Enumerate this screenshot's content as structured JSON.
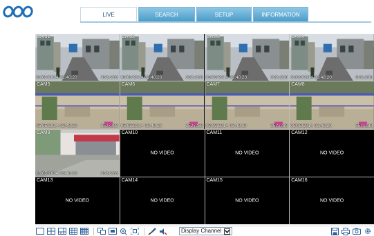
{
  "tabs": [
    {
      "label": "LIVE",
      "active": true
    },
    {
      "label": "SEARCH",
      "active": false
    },
    {
      "label": "SETUP",
      "active": false
    },
    {
      "label": "INFORMATION",
      "active": false
    }
  ],
  "cameras": [
    {
      "label": "CAM1",
      "timestamp": "05/05/2014 03:48:20",
      "resolution": "352x288",
      "status": "video",
      "scene": "street"
    },
    {
      "label": "CAM2",
      "timestamp": "05/05/2014 03:48:20",
      "resolution": "352x288",
      "status": "video",
      "scene": "street"
    },
    {
      "label": "CAM3",
      "timestamp": "05/05/2014 03:48:20",
      "resolution": "352x288",
      "status": "video",
      "scene": "street"
    },
    {
      "label": "CAM4",
      "timestamp": "05/05/2014 03:48:20",
      "resolution": "352x288",
      "status": "video",
      "scene": "street"
    },
    {
      "label": "CAM5",
      "timestamp": "05/05/2014 03:48:20",
      "resolution": "352x288",
      "status": "video",
      "scene": "yard"
    },
    {
      "label": "CAM6",
      "timestamp": "05/05/2014 03:48:20",
      "resolution": "352x288",
      "status": "video",
      "scene": "yard"
    },
    {
      "label": "CAM7",
      "timestamp": "05/05/2014 03:48:20",
      "resolution": "352x288",
      "status": "video",
      "scene": "yard"
    },
    {
      "label": "CAM8",
      "timestamp": "05/05/2014 03:48:20",
      "resolution": "352x288",
      "status": "video",
      "scene": "yard"
    },
    {
      "label": "CAM9",
      "timestamp": "05/05/2014 03:48:20",
      "resolution": "352x288",
      "status": "video",
      "scene": "shop"
    },
    {
      "label": "CAM10",
      "status": "no-video",
      "message": "NO VIDEO"
    },
    {
      "label": "CAM11",
      "status": "no-video",
      "message": "NO VIDEO"
    },
    {
      "label": "CAM12",
      "status": "no-video",
      "message": "NO VIDEO"
    },
    {
      "label": "CAM13",
      "status": "no-video",
      "message": "NO VIDEO"
    },
    {
      "label": "CAM14",
      "status": "no-video",
      "message": "NO VIDEO"
    },
    {
      "label": "CAM15",
      "status": "no-video",
      "message": "NO VIDEO"
    },
    {
      "label": "CAM16",
      "status": "no-video",
      "message": "NO VIDEO"
    }
  ],
  "toolbar": {
    "layout_icons": [
      "layout-1-icon",
      "layout-4-icon",
      "layout-6-icon",
      "layout-9-icon",
      "layout-16-icon"
    ],
    "view_icons": [
      "sequence-icon",
      "fullscreen-window-icon",
      "zoom-in-icon",
      "fit-screen-icon"
    ],
    "tool_icons": [
      "microphone-icon",
      "speaker-icon"
    ],
    "display_select_value": "Display Channel",
    "right_icons": [
      "save-icon",
      "print-icon",
      "snapshot-icon",
      "settings-icon"
    ]
  },
  "colors": {
    "tab_blue": "#5aa8d4",
    "selected_border": "#3bb5c8",
    "logo_blue": "#1f6fb5"
  }
}
